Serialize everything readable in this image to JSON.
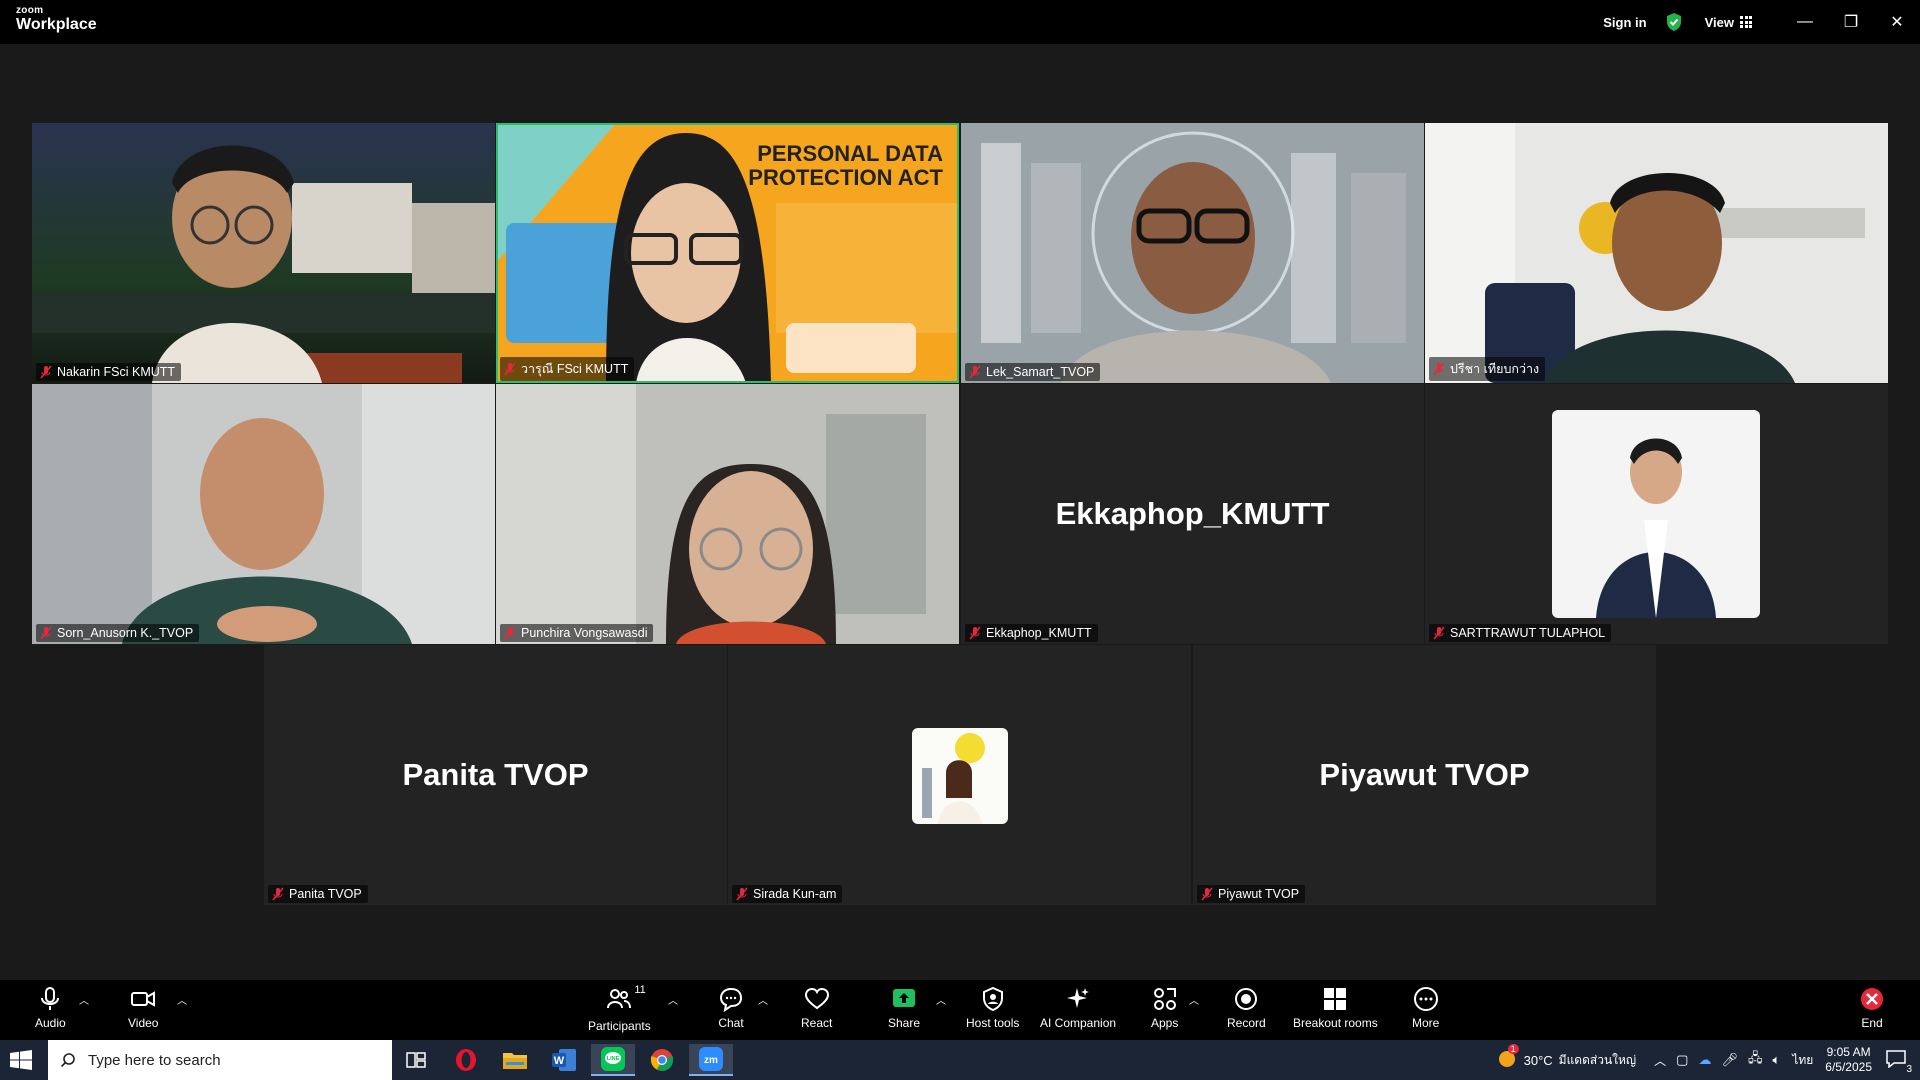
{
  "app": {
    "brand_line1": "zoom",
    "brand_line2": "Workplace"
  },
  "topbar": {
    "sign_in": "Sign in",
    "view": "View",
    "minimize": "—",
    "restore": "❐",
    "close": "✕"
  },
  "participants_row1": [
    {
      "name": "Nakarin FSci KMUTT",
      "muted": true
    },
    {
      "name": "วารุณี FSci KMUTT",
      "muted": true,
      "active_speaker": true,
      "slide": {
        "title_line1": "PERSONAL DATA",
        "title_line2": "PROTECTION ACT"
      }
    },
    {
      "name": "Lek_Samart_TVOP",
      "muted": true
    },
    {
      "name": "ปรีชา เทียบกว่าง",
      "muted": true
    }
  ],
  "participants_row2": [
    {
      "name": "Sorn_Anusorn K._TVOP",
      "muted": true
    },
    {
      "name": "Punchira Vongsawasdi",
      "muted": true
    },
    {
      "name": "Ekkaphop_KMUTT",
      "display": "Ekkaphop_KMUTT",
      "muted": true
    },
    {
      "name": "SARTTRAWUT TULAPHOL",
      "muted": true
    }
  ],
  "participants_row3": [
    {
      "name": "Panita TVOP",
      "display": "Panita TVOP",
      "muted": true
    },
    {
      "name": "Sirada Kun-am",
      "muted": true
    },
    {
      "name": "Piyawut TVOP",
      "display": "Piyawut TVOP",
      "muted": true
    }
  ],
  "toolbar": {
    "audio": "Audio",
    "video": "Video",
    "participants": "Participants",
    "participants_count": "11",
    "chat": "Chat",
    "react": "React",
    "share": "Share",
    "host_tools": "Host tools",
    "ai_companion": "AI Companion",
    "apps": "Apps",
    "record": "Record",
    "breakout_rooms": "Breakout rooms",
    "more": "More",
    "end": "End"
  },
  "taskbar": {
    "search_placeholder": "Type here to search",
    "weather": "30°C",
    "weather_desc": "มีแดดส่วนใหญ่",
    "lang": "ไทย",
    "time": "9:05 AM",
    "date": "6/5/2025",
    "notifications": "3",
    "weather_badge": "1"
  },
  "colors": {
    "active_speaker": "#2dbe6c",
    "end_red": "#e5283c",
    "share_green": "#1fbf5f",
    "muted_red": "#e5283c"
  }
}
